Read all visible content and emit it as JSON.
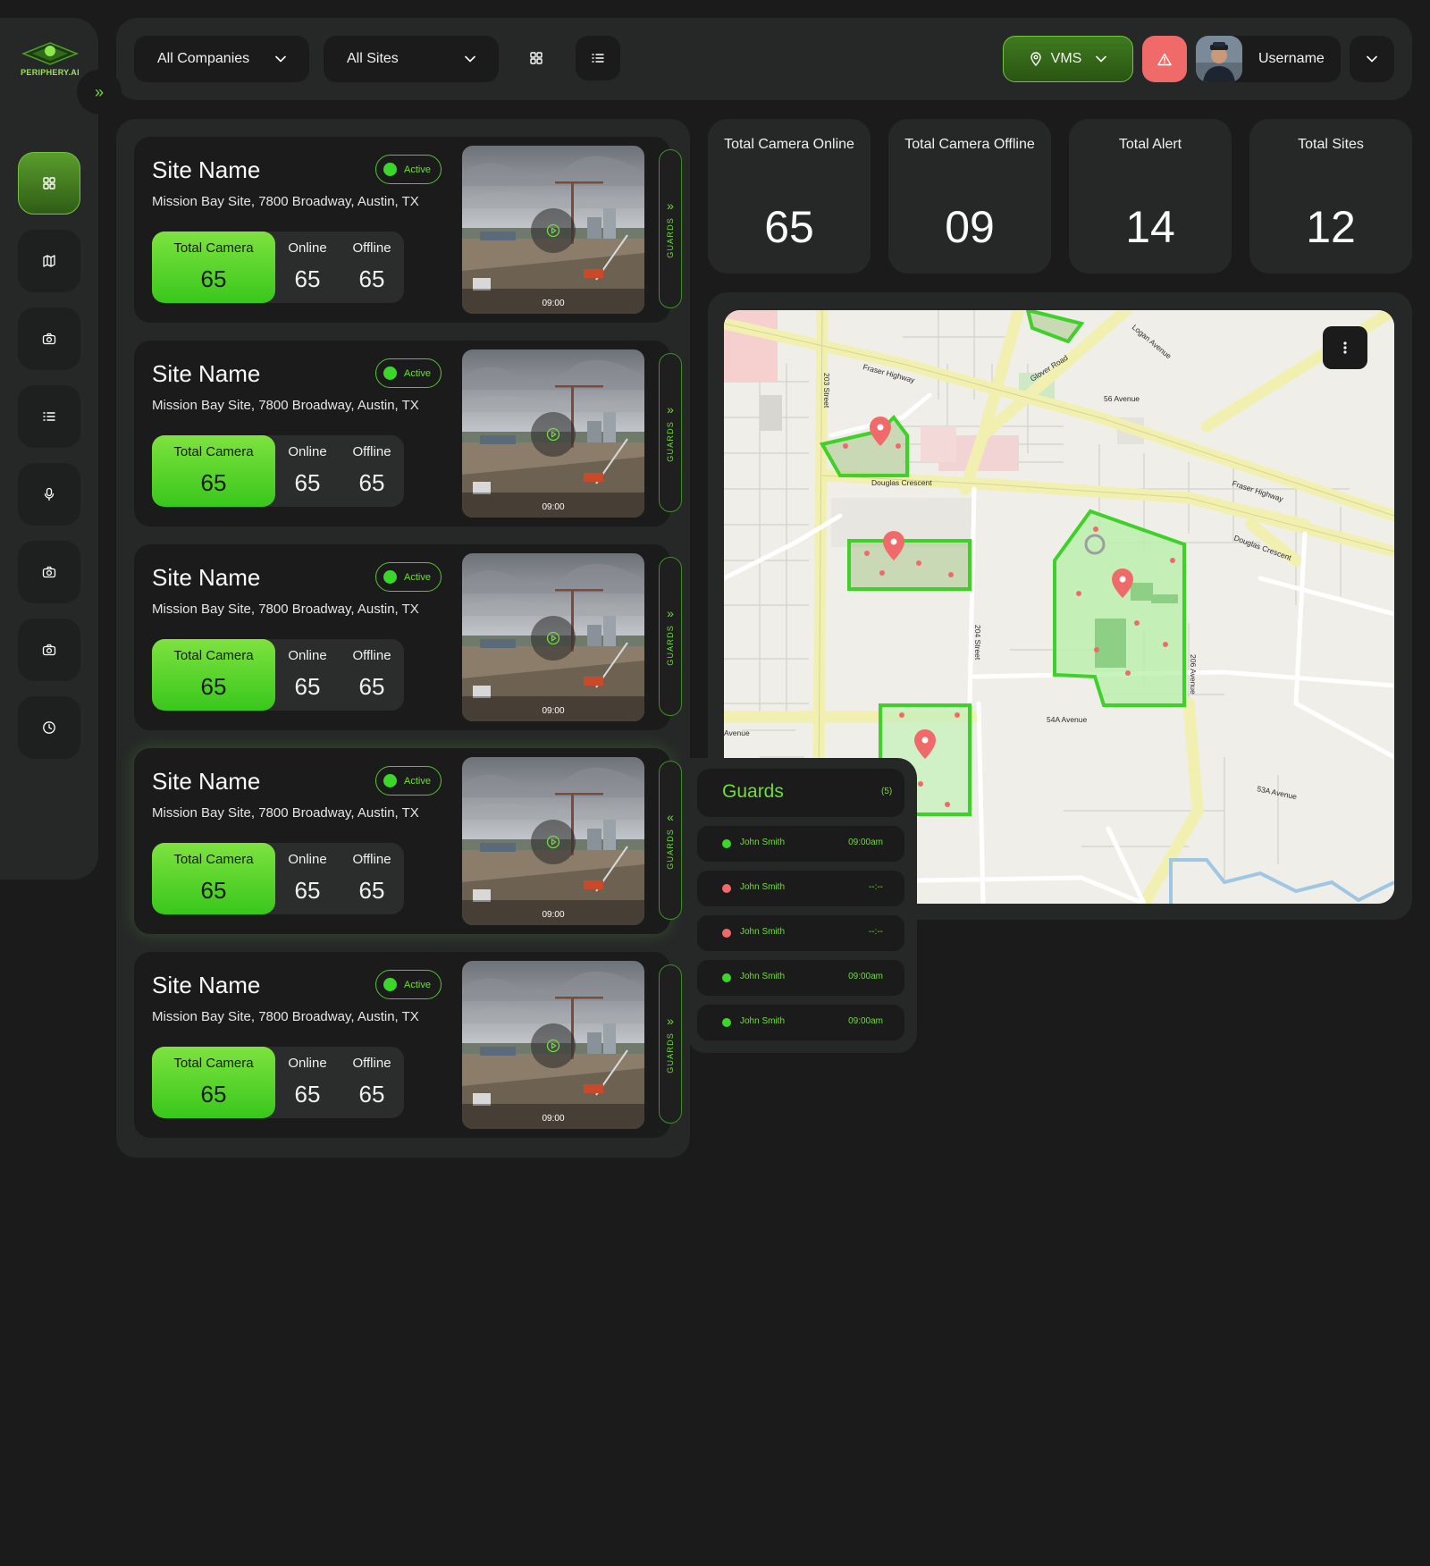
{
  "brand": {
    "name": "PERIPHERY.AI",
    "accent": "#6fdc3a",
    "alert_color": "#f06a6a"
  },
  "sidebar": {
    "expand_label": "»",
    "items": [
      {
        "icon": "dashboard-grid-icon",
        "active": true
      },
      {
        "icon": "map-icon",
        "active": false
      },
      {
        "icon": "camera-icon",
        "active": false
      },
      {
        "icon": "list-icon",
        "active": false
      },
      {
        "icon": "microphone-icon",
        "active": false
      },
      {
        "icon": "camera-icon",
        "active": false
      },
      {
        "icon": "camera-icon",
        "active": false
      },
      {
        "icon": "clock-icon",
        "active": false
      }
    ]
  },
  "topbar": {
    "company_select": "All Companies",
    "site_select": "All Sites",
    "vms_label": "VMS",
    "username": "Username"
  },
  "kpis": [
    {
      "label": "Total Camera Online",
      "value": "65"
    },
    {
      "label": "Total Camera Offline",
      "value": "09"
    },
    {
      "label": "Total Alert",
      "value": "14"
    },
    {
      "label": "Total Sites",
      "value": "12"
    }
  ],
  "site_labels": {
    "total": "Total Camera",
    "online": "Online",
    "offline": "Offline",
    "guards_tab": "GUARDS"
  },
  "sites": [
    {
      "name": "Site Name",
      "status": "Active",
      "address": "Mission Bay Site, 7800 Broadway, Austin, TX",
      "total": "65",
      "online": "65",
      "offline": "65",
      "time": "09:00",
      "guards_chevron": "»"
    },
    {
      "name": "Site Name",
      "status": "Active",
      "address": "Mission Bay Site, 7800 Broadway, Austin, TX",
      "total": "65",
      "online": "65",
      "offline": "65",
      "time": "09:00",
      "guards_chevron": "»"
    },
    {
      "name": "Site Name",
      "status": "Active",
      "address": "Mission Bay Site, 7800 Broadway, Austin, TX",
      "total": "65",
      "online": "65",
      "offline": "65",
      "time": "09:00",
      "guards_chevron": "»"
    },
    {
      "name": "Site Name",
      "status": "Active",
      "address": "Mission Bay Site, 7800 Broadway, Austin, TX",
      "total": "65",
      "online": "65",
      "offline": "65",
      "time": "09:00",
      "guards_chevron": "«"
    },
    {
      "name": "Site Name",
      "status": "Active",
      "address": "Mission Bay Site, 7800 Broadway, Austin, TX",
      "total": "65",
      "online": "65",
      "offline": "65",
      "time": "09:00",
      "guards_chevron": "»"
    }
  ],
  "guards": {
    "title": "Guards",
    "count": "(5)",
    "list": [
      {
        "name": "John Smith",
        "time": "09:00am",
        "status": "online",
        "color": "#3bd62a"
      },
      {
        "name": "John Smith",
        "time": "--:--",
        "status": "offline",
        "color": "#f06a6a"
      },
      {
        "name": "John Smith",
        "time": "--:--",
        "status": "offline",
        "color": "#f06a6a"
      },
      {
        "name": "John Smith",
        "time": "09:00am",
        "status": "online",
        "color": "#3bd62a"
      },
      {
        "name": "John Smith",
        "time": "09:00am",
        "status": "online",
        "color": "#3bd62a"
      }
    ]
  },
  "map": {
    "labels": {
      "fraser_highway": "Fraser Highway",
      "fraser_highway_2": "Fraser Highway",
      "logan_avenue": "Logan Avenue",
      "glover_road": "Glover Road",
      "street_203": "203 Street",
      "avenue_56": "56 Avenue",
      "douglas_crescent": "Douglas Crescent",
      "douglas_crescent_2": "Douglas Crescent",
      "street_204": "204 Street",
      "avenue_206": "206 Avenue",
      "avenue_54a": "54A Avenue",
      "avenue_53a": "53A Avenue",
      "avenue_left": "Avenue"
    }
  }
}
